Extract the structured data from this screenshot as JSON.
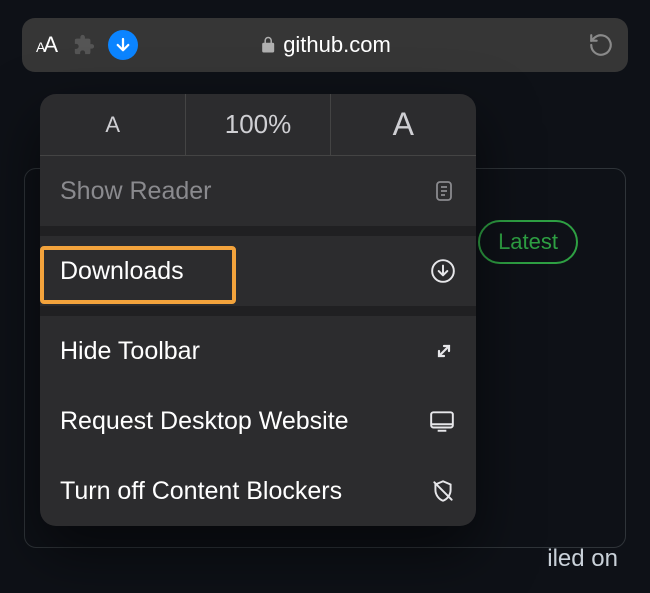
{
  "addressBar": {
    "domain": "github.com"
  },
  "textSize": {
    "decreaseLabel": "A",
    "zoomLevel": "100%",
    "increaseLabel": "A"
  },
  "menu": {
    "showReader": "Show Reader",
    "downloads": "Downloads",
    "hideToolbar": "Hide Toolbar",
    "requestDesktop": "Request Desktop Website",
    "contentBlockers": "Turn off Content Blockers"
  },
  "page": {
    "latestBadge": "Latest",
    "partialText": "iled on"
  }
}
